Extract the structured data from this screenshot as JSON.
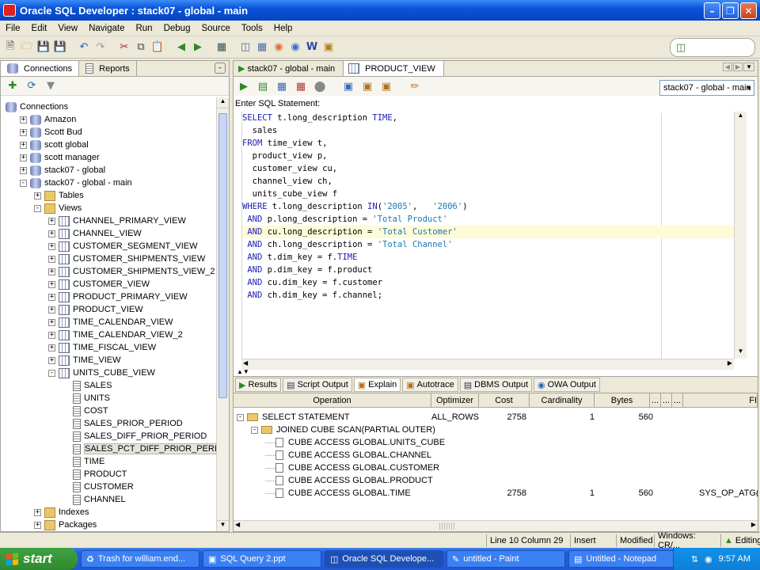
{
  "window": {
    "title": "Oracle SQL Developer : stack07 - global - main"
  },
  "menu": [
    "File",
    "Edit",
    "View",
    "Navigate",
    "Run",
    "Debug",
    "Source",
    "Tools",
    "Help"
  ],
  "left_panel": {
    "tabs": [
      "Connections",
      "Reports"
    ],
    "tree": [
      {
        "label": "Connections",
        "level": 0,
        "icon": "connections",
        "exp": ""
      },
      {
        "label": "Amazon",
        "level": 1,
        "icon": "db",
        "exp": "+"
      },
      {
        "label": "Scott Bud",
        "level": 1,
        "icon": "db",
        "exp": "+"
      },
      {
        "label": "scott global",
        "level": 1,
        "icon": "db",
        "exp": "+"
      },
      {
        "label": "scott manager",
        "level": 1,
        "icon": "db",
        "exp": "+"
      },
      {
        "label": "stack07 - global",
        "level": 1,
        "icon": "db",
        "exp": "+"
      },
      {
        "label": "stack07 - global - main",
        "level": 1,
        "icon": "db",
        "exp": "-"
      },
      {
        "label": "Tables",
        "level": 2,
        "icon": "folder",
        "exp": "+"
      },
      {
        "label": "Views",
        "level": 2,
        "icon": "folder",
        "exp": "-"
      },
      {
        "label": "CHANNEL_PRIMARY_VIEW",
        "level": 3,
        "icon": "view",
        "exp": "+"
      },
      {
        "label": "CHANNEL_VIEW",
        "level": 3,
        "icon": "view",
        "exp": "+"
      },
      {
        "label": "CUSTOMER_SEGMENT_VIEW",
        "level": 3,
        "icon": "view",
        "exp": "+"
      },
      {
        "label": "CUSTOMER_SHIPMENTS_VIEW",
        "level": 3,
        "icon": "view",
        "exp": "+"
      },
      {
        "label": "CUSTOMER_SHIPMENTS_VIEW_2",
        "level": 3,
        "icon": "view",
        "exp": "+"
      },
      {
        "label": "CUSTOMER_VIEW",
        "level": 3,
        "icon": "view",
        "exp": "+"
      },
      {
        "label": "PRODUCT_PRIMARY_VIEW",
        "level": 3,
        "icon": "view",
        "exp": "+"
      },
      {
        "label": "PRODUCT_VIEW",
        "level": 3,
        "icon": "view",
        "exp": "+"
      },
      {
        "label": "TIME_CALENDAR_VIEW",
        "level": 3,
        "icon": "view",
        "exp": "+"
      },
      {
        "label": "TIME_CALENDAR_VIEW_2",
        "level": 3,
        "icon": "view",
        "exp": "+"
      },
      {
        "label": "TIME_FISCAL_VIEW",
        "level": 3,
        "icon": "view",
        "exp": "+"
      },
      {
        "label": "TIME_VIEW",
        "level": 3,
        "icon": "view",
        "exp": "+"
      },
      {
        "label": "UNITS_CUBE_VIEW",
        "level": 3,
        "icon": "view",
        "exp": "-"
      },
      {
        "label": "SALES",
        "level": 4,
        "icon": "col",
        "exp": ""
      },
      {
        "label": "UNITS",
        "level": 4,
        "icon": "col",
        "exp": ""
      },
      {
        "label": "COST",
        "level": 4,
        "icon": "col",
        "exp": ""
      },
      {
        "label": "SALES_PRIOR_PERIOD",
        "level": 4,
        "icon": "col",
        "exp": ""
      },
      {
        "label": "SALES_DIFF_PRIOR_PERIOD",
        "level": 4,
        "icon": "col",
        "exp": ""
      },
      {
        "label": "SALES_PCT_DIFF_PRIOR_PERI",
        "level": 4,
        "icon": "col",
        "exp": "",
        "selected": true
      },
      {
        "label": "TIME",
        "level": 4,
        "icon": "col",
        "exp": ""
      },
      {
        "label": "PRODUCT",
        "level": 4,
        "icon": "col",
        "exp": ""
      },
      {
        "label": "CUSTOMER",
        "level": 4,
        "icon": "col",
        "exp": ""
      },
      {
        "label": "CHANNEL",
        "level": 4,
        "icon": "col",
        "exp": ""
      },
      {
        "label": "Indexes",
        "level": 2,
        "icon": "folder",
        "exp": "+"
      },
      {
        "label": "Packages",
        "level": 2,
        "icon": "folder",
        "exp": "+"
      }
    ]
  },
  "editor": {
    "tabs": [
      "stack07 - global - main",
      "PRODUCT_VIEW"
    ],
    "connection": "stack07 - global - main",
    "enter_label": "Enter SQL Statement:",
    "lines": [
      [
        {
          "t": "SELECT",
          "k": "kw"
        },
        {
          "t": " t.long_description "
        },
        {
          "t": "TIME",
          "k": "kw"
        },
        {
          "t": ","
        }
      ],
      [
        {
          "t": "  sales"
        }
      ],
      [
        {
          "t": "FROM",
          "k": "kw"
        },
        {
          "t": " time_view t,"
        }
      ],
      [
        {
          "t": "  product_view p,"
        }
      ],
      [
        {
          "t": "  customer_view cu,"
        }
      ],
      [
        {
          "t": "  channel_view ch,"
        }
      ],
      [
        {
          "t": "  units_cube_view f"
        }
      ],
      [
        {
          "t": "WHERE",
          "k": "kw"
        },
        {
          "t": " t.long_description "
        },
        {
          "t": "IN",
          "k": "kw"
        },
        {
          "t": "("
        },
        {
          "t": "'2005'",
          "k": "str"
        },
        {
          "t": ",   "
        },
        {
          "t": "'2006'",
          "k": "str"
        },
        {
          "t": ")"
        }
      ],
      [
        {
          "t": " AND",
          "k": "kw"
        },
        {
          "t": " p.long_description = "
        },
        {
          "t": "'Total Product'",
          "k": "str"
        }
      ],
      [
        {
          "t": " AND",
          "k": "kw"
        },
        {
          "t": " cu.long_description = "
        },
        {
          "t": "'Total Customer'",
          "k": "str"
        }
      ],
      [
        {
          "t": " AND",
          "k": "kw"
        },
        {
          "t": " ch.long_description = "
        },
        {
          "t": "'Total Channel'",
          "k": "str"
        }
      ],
      [
        {
          "t": " AND",
          "k": "kw"
        },
        {
          "t": " t.dim_key = f."
        },
        {
          "t": "TIME",
          "k": "kw"
        }
      ],
      [
        {
          "t": " AND",
          "k": "kw"
        },
        {
          "t": " p.dim_key = f.product"
        }
      ],
      [
        {
          "t": " AND",
          "k": "kw"
        },
        {
          "t": " cu.dim_key = f.customer"
        }
      ],
      [
        {
          "t": " AND",
          "k": "kw"
        },
        {
          "t": " ch.dim_key = f.channel;"
        }
      ]
    ],
    "current_line": 9
  },
  "results": {
    "tabs": [
      "Results",
      "Script Output",
      "Explain",
      "Autotrace",
      "DBMS Output",
      "OWA Output"
    ],
    "active_tab": 2,
    "columns": [
      "Operation",
      "Optimizer",
      "Cost",
      "Cardinality",
      "Bytes",
      "...",
      "...",
      "...",
      "FI"
    ],
    "rows": [
      {
        "operation": "SELECT STATEMENT",
        "level": 0,
        "type": "folder",
        "exp": "-",
        "optimizer": "ALL_ROWS",
        "cost": "2758",
        "cardinality": "1",
        "bytes": "560",
        "extra": ""
      },
      {
        "operation": "JOINED CUBE SCAN(PARTIAL OUTER)",
        "level": 1,
        "type": "folder",
        "exp": "-",
        "optimizer": "",
        "cost": "",
        "cardinality": "",
        "bytes": "",
        "extra": ""
      },
      {
        "operation": "CUBE ACCESS GLOBAL.UNITS_CUBE",
        "level": 2,
        "type": "doc",
        "exp": "",
        "optimizer": "",
        "cost": "",
        "cardinality": "",
        "bytes": "",
        "extra": ""
      },
      {
        "operation": "CUBE ACCESS GLOBAL.CHANNEL",
        "level": 2,
        "type": "doc",
        "exp": "",
        "optimizer": "",
        "cost": "",
        "cardinality": "",
        "bytes": "",
        "extra": ""
      },
      {
        "operation": "CUBE ACCESS GLOBAL.CUSTOMER",
        "level": 2,
        "type": "doc",
        "exp": "",
        "optimizer": "",
        "cost": "",
        "cardinality": "",
        "bytes": "",
        "extra": ""
      },
      {
        "operation": "CUBE ACCESS GLOBAL.PRODUCT",
        "level": 2,
        "type": "doc",
        "exp": "",
        "optimizer": "",
        "cost": "",
        "cardinality": "",
        "bytes": "",
        "extra": ""
      },
      {
        "operation": "CUBE ACCESS GLOBAL.TIME",
        "level": 2,
        "type": "doc",
        "exp": "",
        "optimizer": "",
        "cost": "2758",
        "cardinality": "1",
        "bytes": "560",
        "extra": "SYS_OP_ATG("
      }
    ]
  },
  "status": {
    "position": "Line 10 Column 29",
    "mode": "Insert",
    "modified": "Modified",
    "encoding": "Windows: CR/...",
    "editing": "Editing"
  },
  "taskbar": {
    "start": "start",
    "tasks": [
      "Trash for william.end...",
      "SQL Query 2.ppt",
      "Oracle SQL Develope...",
      "untitled - Paint",
      "Untitled - Notepad"
    ],
    "active_task": 2,
    "clock": "9:57 AM"
  }
}
